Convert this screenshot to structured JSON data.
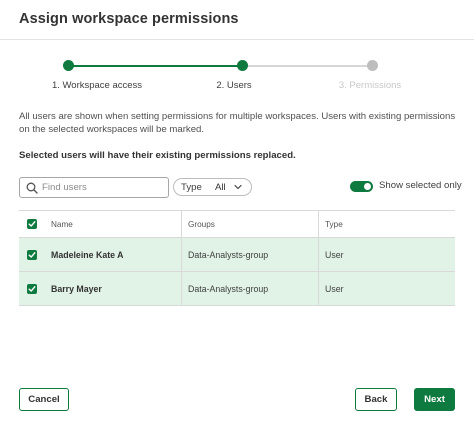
{
  "dialog": {
    "title": "Assign workspace permissions"
  },
  "stepper": {
    "steps": [
      {
        "label": "1. Workspace access",
        "state": "done"
      },
      {
        "label": "2. Users",
        "state": "current"
      },
      {
        "label": "3. Permissions",
        "state": "todo"
      }
    ]
  },
  "info_text": "All users are shown when setting permissions for multiple workspaces. Users with existing permissions on the selected workspaces will be marked.",
  "warning_text": "Selected users will have their existing permissions replaced.",
  "filters": {
    "search_placeholder": "Find users",
    "type_label": "Type",
    "type_value": "All",
    "show_selected_label": "Show selected only",
    "show_selected_on": true
  },
  "table": {
    "headers": {
      "name": "Name",
      "groups": "Groups",
      "type": "Type"
    },
    "rows": [
      {
        "name": "Madeleine Kate A",
        "groups": "Data-Analysts-group",
        "type": "User",
        "selected": true
      },
      {
        "name": "Barry Mayer",
        "groups": "Data-Analysts-group",
        "type": "User",
        "selected": true
      }
    ]
  },
  "footer": {
    "cancel_label": "Cancel",
    "back_label": "Back",
    "next_label": "Next"
  },
  "colors": {
    "accent": "#0f7a3f",
    "selected_row": "#e1f3e6"
  },
  "icons": {
    "search": "search-icon",
    "chevron": "chevron-down-icon",
    "check": "check-icon"
  }
}
